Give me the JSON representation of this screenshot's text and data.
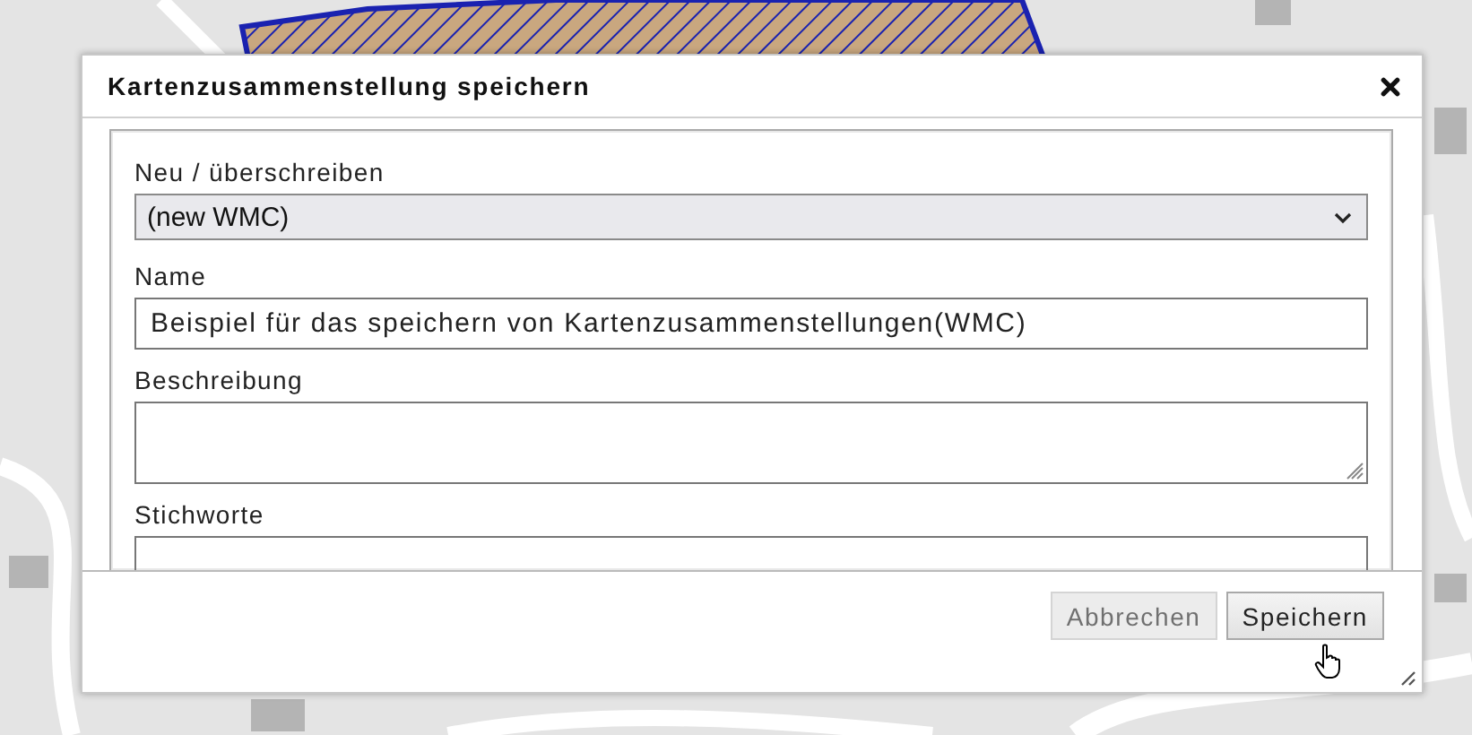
{
  "dialog": {
    "title": "Kartenzusammenstellung speichern",
    "fields": [
      {
        "kind": "select",
        "label": "Neu / überschreiben",
        "value": "(new WMC)"
      },
      {
        "kind": "text",
        "label": "Name",
        "value": "Beispiel für das speichern von Kartenzusammenstellungen(WMC)"
      },
      {
        "kind": "textarea",
        "label": "Beschreibung"
      },
      {
        "kind": "text",
        "label": "Stichworte"
      }
    ],
    "buttons": [
      {
        "label": "Abbrechen",
        "disabled": true
      },
      {
        "label": "Speichern",
        "disabled": false
      }
    ]
  }
}
